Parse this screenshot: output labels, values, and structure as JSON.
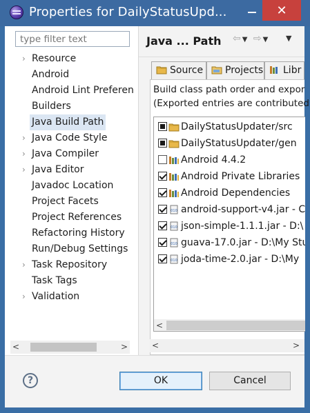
{
  "window": {
    "title": "Properties for DailyStatusUpd...",
    "minimize_glyph": "",
    "close_glyph": "✕"
  },
  "left": {
    "filter_placeholder": "type filter text",
    "items": [
      {
        "label": "Resource",
        "expandable": true
      },
      {
        "label": "Android",
        "expandable": false
      },
      {
        "label": "Android Lint Preferen",
        "expandable": false
      },
      {
        "label": "Builders",
        "expandable": false
      },
      {
        "label": "Java Build Path",
        "expandable": false,
        "selected": true
      },
      {
        "label": "Java Code Style",
        "expandable": true
      },
      {
        "label": "Java Compiler",
        "expandable": true
      },
      {
        "label": "Java Editor",
        "expandable": true
      },
      {
        "label": "Javadoc Location",
        "expandable": false
      },
      {
        "label": "Project Facets",
        "expandable": false
      },
      {
        "label": "Project References",
        "expandable": false
      },
      {
        "label": "Refactoring History",
        "expandable": false
      },
      {
        "label": "Run/Debug Settings",
        "expandable": false
      },
      {
        "label": "Task Repository",
        "expandable": true
      },
      {
        "label": "Task Tags",
        "expandable": false
      },
      {
        "label": "Validation",
        "expandable": true
      }
    ]
  },
  "right": {
    "page_title": "Java ... Path",
    "tabs": [
      {
        "label": "Source",
        "icon": "source-folder-icon"
      },
      {
        "label": "Projects",
        "icon": "projects-icon"
      },
      {
        "label": "Libr",
        "icon": "libraries-icon"
      }
    ],
    "description_line1": "Build class path order and expor",
    "description_line2": "(Exported entries are contributed",
    "entries": [
      {
        "label": "DailyStatusUpdater/src",
        "check": "square",
        "icon": "source-folder-icon"
      },
      {
        "label": "DailyStatusUpdater/gen",
        "check": "square",
        "icon": "source-folder-icon"
      },
      {
        "label": "Android 4.4.2",
        "check": "empty",
        "icon": "library-icon"
      },
      {
        "label": "Android Private Libraries",
        "check": "checked",
        "icon": "library-icon"
      },
      {
        "label": "Android Dependencies",
        "check": "checked",
        "icon": "library-icon"
      },
      {
        "label": "android-support-v4.jar - C",
        "check": "checked",
        "icon": "jar-icon"
      },
      {
        "label": "json-simple-1.1.1.jar - D:\\",
        "check": "checked",
        "icon": "jar-icon"
      },
      {
        "label": "guava-17.0.jar - D:\\My Stu",
        "check": "checked",
        "icon": "jar-icon"
      },
      {
        "label": "joda-time-2.0.jar - D:\\My",
        "check": "checked",
        "icon": "jar-icon"
      }
    ]
  },
  "buttons": {
    "help": "?",
    "ok": "OK",
    "cancel": "Cancel"
  },
  "colors": {
    "titlebar": "#3c6aa1",
    "close_button": "#c7413d",
    "selection": "#dbe6f3",
    "ok_border": "#3c7fb1"
  }
}
